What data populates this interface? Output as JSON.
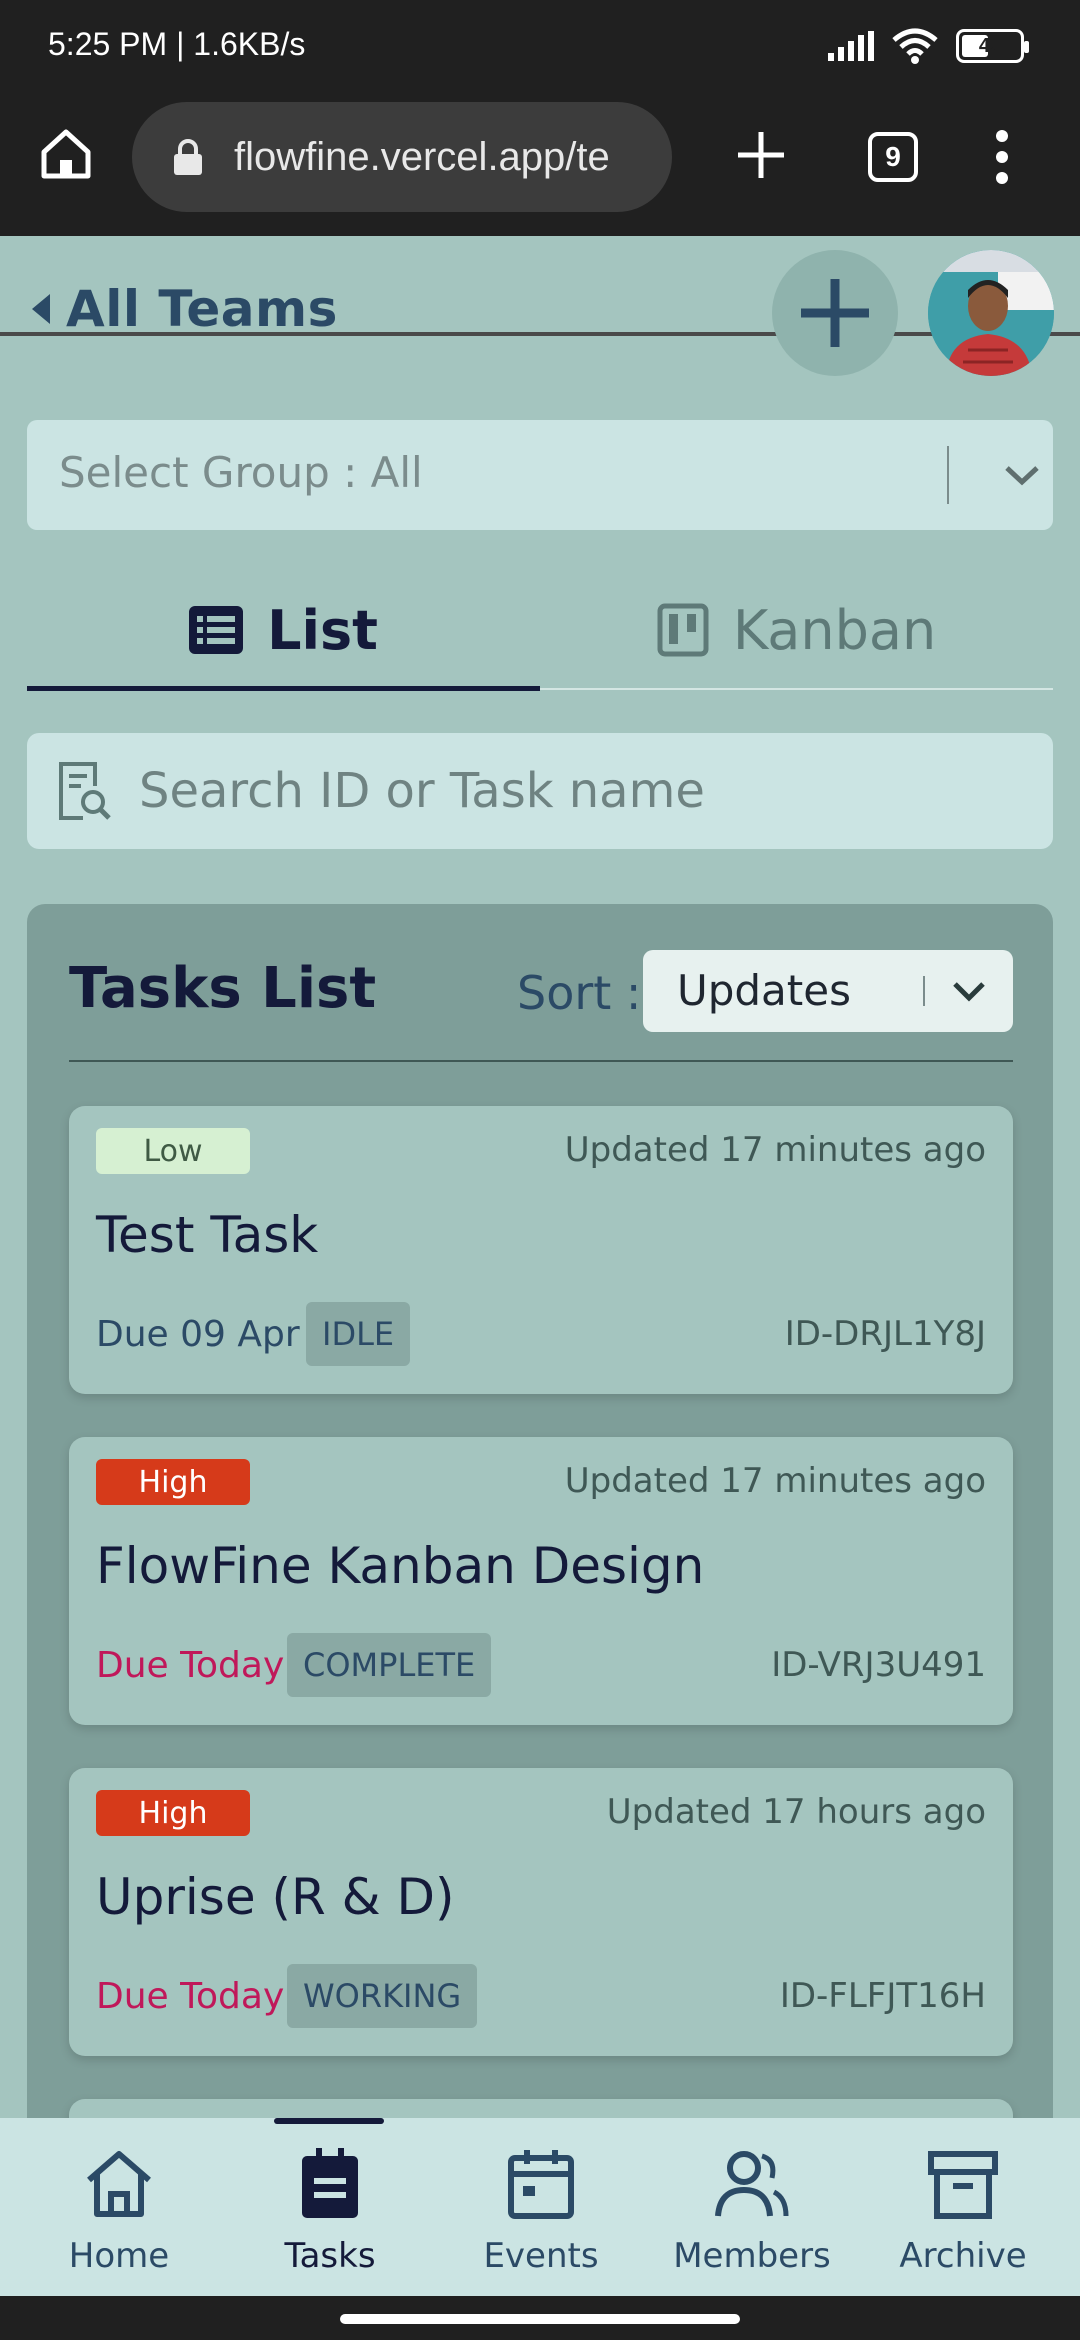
{
  "status_bar": {
    "time": "5:25 PM | 1.6KB/s",
    "battery": "42"
  },
  "browser": {
    "url": "flowfine.vercel.app/te",
    "tab_count": "9"
  },
  "header": {
    "back_label": "All Teams"
  },
  "group_select": {
    "label": "Select Group : All"
  },
  "view_tabs": [
    {
      "label": "List",
      "active": true
    },
    {
      "label": "Kanban",
      "active": false
    }
  ],
  "search": {
    "placeholder": "Search ID or Task name"
  },
  "tasks_panel": {
    "title": "Tasks List",
    "sort_label": "Sort :",
    "sort_value": "Updates",
    "tasks": [
      {
        "priority": "Low",
        "updated": "Updated 17 minutes ago",
        "title": "Test Task",
        "due": "Due 09 Apr",
        "status": "IDLE",
        "id": "ID-DRJL1Y8J"
      },
      {
        "priority": "High",
        "updated": "Updated 17 minutes ago",
        "title": "FlowFine Kanban Design",
        "due": "Due Today",
        "status": "COMPLETE",
        "id": "ID-VRJ3U491"
      },
      {
        "priority": "High",
        "updated": "Updated 17 hours ago",
        "title": "Uprise (R & D)",
        "due": "Due Today",
        "status": "WORKING",
        "id": "ID-FLFJT16H"
      }
    ]
  },
  "bottom_nav": [
    {
      "label": "Home",
      "icon": "home-icon",
      "active": false
    },
    {
      "label": "Tasks",
      "icon": "clipboard-icon",
      "active": true
    },
    {
      "label": "Events",
      "icon": "calendar-icon",
      "active": false
    },
    {
      "label": "Members",
      "icon": "members-icon",
      "active": false
    },
    {
      "label": "Archive",
      "icon": "archive-icon",
      "active": false
    }
  ],
  "colors": {
    "background": "#a4c5bf",
    "panel": "#7e9e99",
    "dark": "#141a3a",
    "high_priority": "#d63a1a",
    "low_priority": "#d6f0d2",
    "due_today": "#c0185a"
  }
}
